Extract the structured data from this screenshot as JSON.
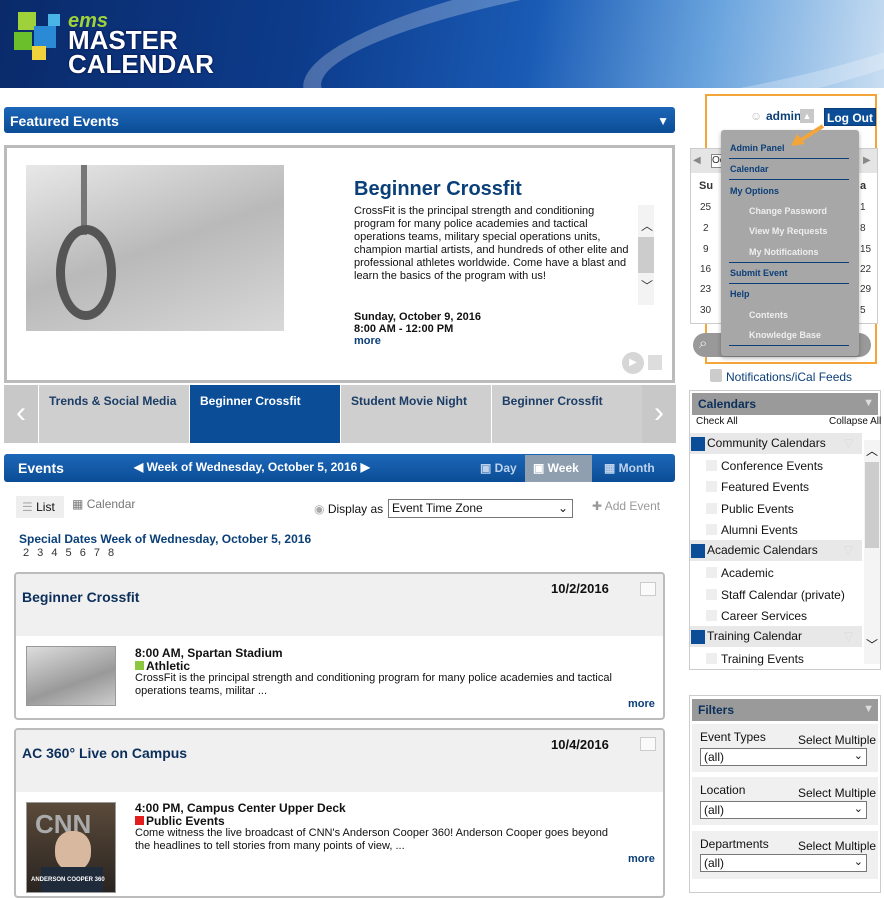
{
  "brand": {
    "ems": "ems",
    "title_line1": "MASTER",
    "title_line2": "CALENDAR"
  },
  "featured": {
    "bar_title": "Featured Events",
    "title": "Beginner Crossfit",
    "description": "CrossFit is the principal strength and conditioning program for many police academies and tactical operations teams, military special operations units, champion martial artists, and hundreds of other elite and professional athletes worldwide. Come have a blast and learn the basics of the program with us!",
    "date": "Sunday, October 9, 2016",
    "time": "8:00 AM - 12:00 PM",
    "more": "more"
  },
  "carousel": {
    "tabs": [
      {
        "label": "Trends & Social Media"
      },
      {
        "label": "Beginner Crossfit"
      },
      {
        "label": "Student Movie Night"
      },
      {
        "label": "Beginner Crossfit"
      }
    ],
    "active_index": 1
  },
  "events": {
    "title": "Events",
    "week_label": "Week of Wednesday, October 5, 2016",
    "views": {
      "day": "Day",
      "week": "Week",
      "month": "Month"
    },
    "list_tab": "List",
    "calendar_tab": "Calendar",
    "display_as": "Display as",
    "timezone": "Event Time Zone",
    "add_event": "Add Event",
    "special_title": "Special Dates Week of Wednesday, October 5, 2016",
    "special_days": "2 3 4 5 6 7 8",
    "items": [
      {
        "title": "Beginner Crossfit",
        "date": "10/2/2016",
        "time_location": "8:00 AM, Spartan Stadium",
        "category": "Athletic",
        "category_color": "#8dc63f",
        "description": "CrossFit is the principal strength and conditioning program for many police academies and tactical operations teams, militar ...",
        "more": "more"
      },
      {
        "title": "AC 360° Live on Campus",
        "date": "10/4/2016",
        "time_location": "4:00 PM, Campus Center Upper Deck",
        "category": "Public Events",
        "category_color": "#e11d1d",
        "description": "Come witness the live broadcast of CNN's Anderson Cooper 360! Anderson Cooper goes beyond the headlines to tell stories from many points of view, ...",
        "more": "more",
        "thumb_text": "ANDERSON COOPER 360"
      }
    ]
  },
  "user": {
    "name": "admin",
    "logout": "Log Out"
  },
  "admin_menu": {
    "items": [
      {
        "label": "Admin Panel",
        "sub": false
      },
      {
        "label": "Calendar",
        "sub": false
      },
      {
        "label": "My Options",
        "sub": false
      },
      {
        "label": "Change Password",
        "sub": true
      },
      {
        "label": "View My Requests",
        "sub": true
      },
      {
        "label": "My Notifications",
        "sub": true
      },
      {
        "label": "Submit Event",
        "sub": false
      },
      {
        "label": "Help",
        "sub": false
      },
      {
        "label": "Contents",
        "sub": true
      },
      {
        "label": "Knowledge Base",
        "sub": true
      }
    ]
  },
  "mini_calendar": {
    "month_partial": "Oc",
    "first_day": "Su",
    "last_day_partial": "a",
    "left_days": [
      "25",
      "2",
      "9",
      "16",
      "23",
      "30"
    ],
    "right_days": [
      "1",
      "8",
      "15",
      "22",
      "29",
      "5"
    ]
  },
  "notifications": "Notifications/iCal Feeds",
  "calendars": {
    "title": "Calendars",
    "check_all": "Check All",
    "collapse_all": "Collapse All",
    "groups": [
      {
        "label": "Community Calendars",
        "items": [
          "Conference Events",
          "Featured Events",
          "Public Events",
          "Alumni Events"
        ]
      },
      {
        "label": "Academic Calendars",
        "items": [
          "Academic",
          "Staff Calendar (private)",
          "Career Services"
        ]
      },
      {
        "label": "Training Calendar",
        "items": [
          "Training Events"
        ]
      }
    ]
  },
  "filters": {
    "title": "Filters",
    "select_multiple": "Select Multiple",
    "items": [
      {
        "label": "Event Types",
        "value": "(all)"
      },
      {
        "label": "Location",
        "value": "(all)"
      },
      {
        "label": "Departments",
        "value": "(all)"
      }
    ]
  },
  "colors": {
    "brand_blue": "#0b4d96",
    "accent_orange": "#f3a53a",
    "athletic_green": "#8dc63f",
    "public_red": "#e11d1d"
  }
}
